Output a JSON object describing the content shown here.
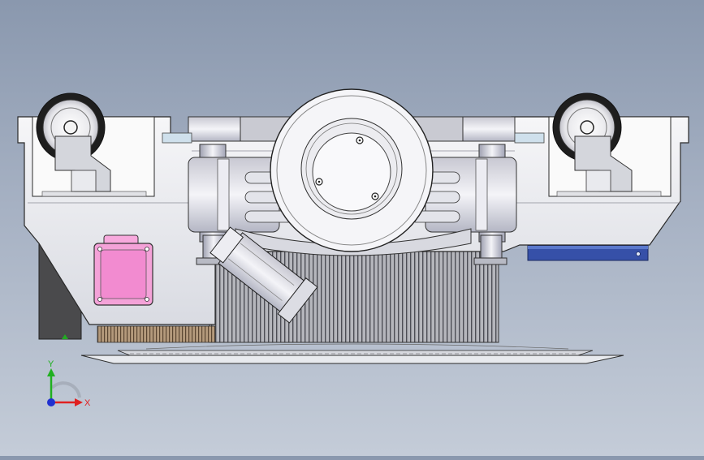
{
  "viewport": {
    "background_top": "#8a98ae",
    "background_bottom": "#c4ccd8",
    "model_colors": {
      "body": "#f2f2f4",
      "outline": "#2a2a2a",
      "motor_housing": "#d8d8e2",
      "connector": "#f28bd0",
      "bracket": "#3650a8",
      "heatsink": "#9a9aa0",
      "battery": "#4a4a4a"
    }
  },
  "triad": {
    "x_label": "X",
    "y_label": "Y",
    "x_color": "#e02020",
    "y_color": "#20b020",
    "z_color": "#2030d0"
  }
}
